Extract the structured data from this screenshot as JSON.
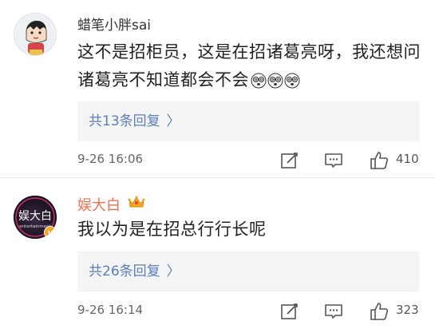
{
  "comments": [
    {
      "username": "蜡笔小胖sai",
      "text": "这不是招柜员，这是在招诸葛亮呀，我还想问诸葛亮不知道都会不会",
      "emojis": [
        "dizzy-face-icon",
        "dizzy-face-icon",
        "dizzy-face-icon"
      ],
      "reply_label": "共13条回复",
      "time": "9-26 16:06",
      "likes": "410"
    },
    {
      "username": "娱大白",
      "badge": "crown-icon",
      "avatar_text": "娱大白",
      "avatar_subtext": "entertainment",
      "text": "我以为是在招总行行长呢",
      "reply_label": "共26条回复",
      "time": "9-26 16:14",
      "likes": "323"
    }
  ],
  "colors": {
    "username_vip": "#eb7350",
    "reply_link": "#5a7fb5",
    "reply_bg": "#f4f4f4",
    "crown": "#f5a623"
  }
}
